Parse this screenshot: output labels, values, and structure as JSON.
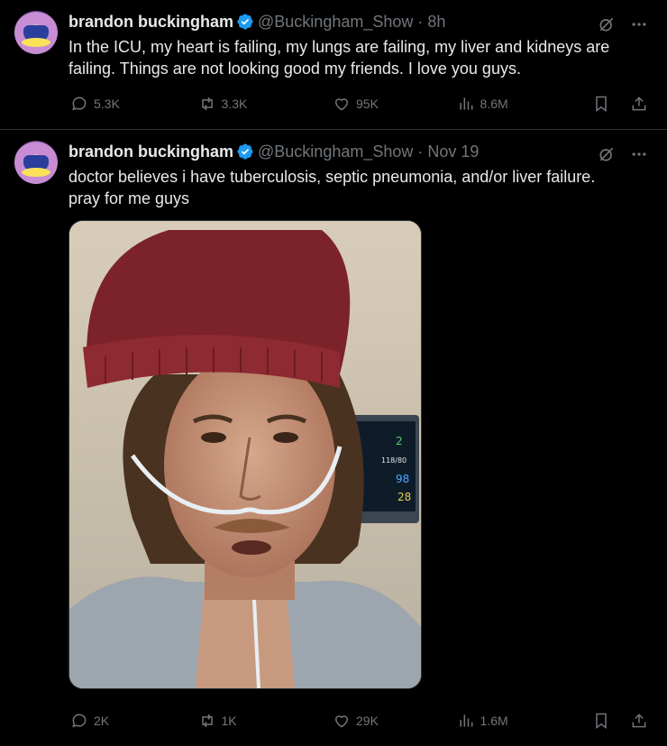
{
  "tweets": [
    {
      "name": "brandon buckingham",
      "handle": "@Buckingham_Show",
      "time": "8h",
      "text": "In the ICU, my heart is failing, my lungs are failing, my liver and kidneys are\nfailing. Things are not looking good my friends. I love you guys.",
      "replies": "5.3K",
      "retweets": "3.3K",
      "likes": "95K",
      "views": "8.6M"
    },
    {
      "name": "brandon buckingham",
      "handle": "@Buckingham_Show",
      "time": "Nov 19",
      "text": "doctor believes i have tuberculosis, septic pneumonia, and/or liver failure.\npray for me guys",
      "replies": "2K",
      "retweets": "1K",
      "likes": "29K",
      "views": "1.6M",
      "media": {
        "monitor_values": [
          "2",
          "118/80",
          "98",
          "28"
        ]
      }
    }
  ],
  "colors": {
    "background": "#000000",
    "text": "#e7e9ea",
    "muted": "#71767b",
    "verified": "#1d9bf0",
    "divider": "#2f3336"
  },
  "icons": [
    "verified-badge-icon",
    "grok-icon",
    "more-icon",
    "reply-icon",
    "retweet-icon",
    "like-icon",
    "views-icon",
    "bookmark-icon",
    "share-icon"
  ]
}
